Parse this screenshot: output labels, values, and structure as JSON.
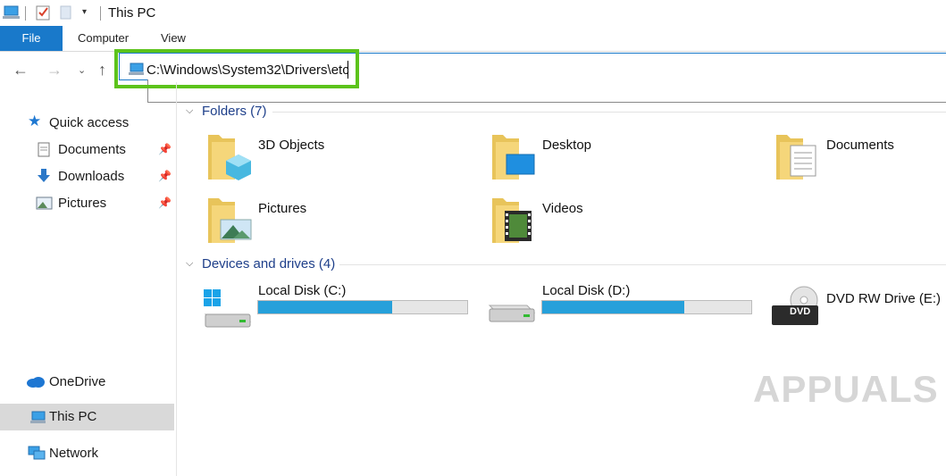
{
  "window": {
    "title": "This PC"
  },
  "ribbon": {
    "tabs": [
      "File",
      "Computer",
      "View"
    ]
  },
  "address": {
    "path": "C:\\Windows\\System32\\Drivers\\etc"
  },
  "sidebar": {
    "items": [
      {
        "label": "Quick access"
      },
      {
        "label": "Documents"
      },
      {
        "label": "Downloads"
      },
      {
        "label": "Pictures"
      },
      {
        "label": "OneDrive"
      },
      {
        "label": "This PC"
      },
      {
        "label": "Network"
      }
    ]
  },
  "folders": {
    "header": "Folders (7)",
    "items": [
      {
        "label": "3D Objects",
        "icon": "3d-objects-icon"
      },
      {
        "label": "Desktop",
        "icon": "desktop-icon"
      },
      {
        "label": "Documents",
        "icon": "documents-icon"
      },
      {
        "label": "Pictures",
        "icon": "pictures-icon"
      },
      {
        "label": "Videos",
        "icon": "videos-icon"
      }
    ]
  },
  "drives": {
    "header": "Devices and drives (4)",
    "items": [
      {
        "label": "Local Disk (C:)",
        "used_fraction": 0.64
      },
      {
        "label": "Local Disk (D:)",
        "used_fraction": 0.68
      },
      {
        "label": "DVD RW Drive (E:)",
        "badge": "DVD"
      }
    ]
  },
  "watermark": {
    "text": "APPUALS"
  },
  "colors": {
    "accent": "#1979ca",
    "highlight": "#5cc31b",
    "bar_fill": "#26a0da",
    "group_header": "#1e3f8a"
  }
}
